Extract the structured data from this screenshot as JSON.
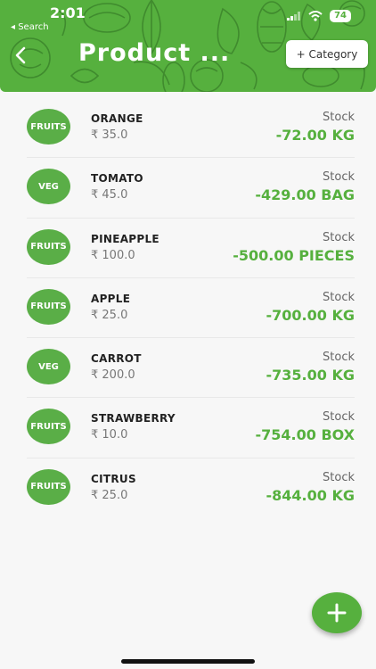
{
  "status_bar": {
    "time": "2:01",
    "back_label": "◂ Search",
    "battery": "74"
  },
  "header": {
    "title": "Product ...",
    "category_button": "+ Category"
  },
  "products": [
    {
      "category": "FRUITS",
      "name": "ORANGE",
      "price": "₹ 35.0",
      "stock_label": "Stock",
      "stock": "-72.00 KG"
    },
    {
      "category": "VEG",
      "name": "TOMATO",
      "price": "₹ 45.0",
      "stock_label": "Stock",
      "stock": "-429.00 BAG"
    },
    {
      "category": "FRUITS",
      "name": "PINEAPPLE",
      "price": "₹ 100.0",
      "stock_label": "Stock",
      "stock": "-500.00 PIECES"
    },
    {
      "category": "FRUITS",
      "name": "APPLE",
      "price": "₹ 25.0",
      "stock_label": "Stock",
      "stock": "-700.00 KG"
    },
    {
      "category": "VEG",
      "name": "CARROT",
      "price": "₹ 200.0",
      "stock_label": "Stock",
      "stock": "-735.00 KG"
    },
    {
      "category": "FRUITS",
      "name": "STRAWBERRY",
      "price": "₹ 10.0",
      "stock_label": "Stock",
      "stock": "-754.00 BOX"
    },
    {
      "category": "FRUITS",
      "name": "CITRUS",
      "price": "₹ 25.0",
      "stock_label": "Stock",
      "stock": "-844.00 KG"
    }
  ],
  "colors": {
    "accent": "#56b03e",
    "badge": "#5aae47"
  }
}
